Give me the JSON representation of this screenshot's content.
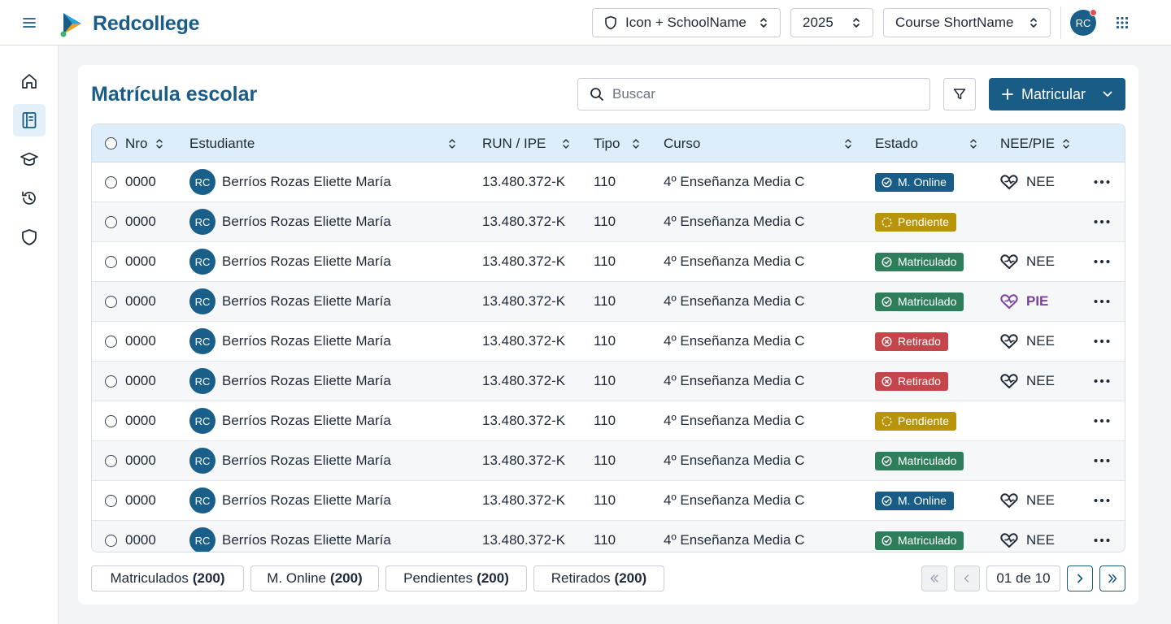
{
  "app": {
    "name": "Redcollege"
  },
  "topbar": {
    "school_select": "Icon + SchoolName",
    "year_select": "2025",
    "course_select": "Course ShortName",
    "user_initials": "RC"
  },
  "page": {
    "title": "Matrícula escolar",
    "search_placeholder": "Buscar",
    "primary_action": "Matricular"
  },
  "table": {
    "headers": {
      "nro": "Nro",
      "estudiante": "Estudiante",
      "run": "RUN / IPE",
      "tipo": "Tipo",
      "curso": "Curso",
      "estado": "Estado",
      "nee": "NEE/PIE"
    },
    "rows": [
      {
        "nro": "0000",
        "initials": "RC",
        "name": "Berríos Rozas Eliette María",
        "run": "13.480.372-K",
        "tipo": "110",
        "curso": "4º Enseñanza Media C",
        "estado": "M. Online",
        "estado_kind": "online",
        "nee": "NEE",
        "nee_kind": "nee"
      },
      {
        "nro": "0000",
        "initials": "RC",
        "name": "Berríos Rozas Eliette María",
        "run": "13.480.372-K",
        "tipo": "110",
        "curso": "4º Enseñanza Media C",
        "estado": "Pendiente",
        "estado_kind": "pendiente",
        "nee": "",
        "nee_kind": "none"
      },
      {
        "nro": "0000",
        "initials": "RC",
        "name": "Berríos Rozas Eliette María",
        "run": "13.480.372-K",
        "tipo": "110",
        "curso": "4º Enseñanza Media C",
        "estado": "Matriculado",
        "estado_kind": "matriculado",
        "nee": "NEE",
        "nee_kind": "nee"
      },
      {
        "nro": "0000",
        "initials": "RC",
        "name": "Berríos Rozas Eliette María",
        "run": "13.480.372-K",
        "tipo": "110",
        "curso": "4º Enseñanza Media C",
        "estado": "Matriculado",
        "estado_kind": "matriculado",
        "nee": "PIE",
        "nee_kind": "pie"
      },
      {
        "nro": "0000",
        "initials": "RC",
        "name": "Berríos Rozas Eliette María",
        "run": "13.480.372-K",
        "tipo": "110",
        "curso": "4º Enseñanza Media C",
        "estado": "Retirado",
        "estado_kind": "retirado",
        "nee": "NEE",
        "nee_kind": "nee"
      },
      {
        "nro": "0000",
        "initials": "RC",
        "name": "Berríos Rozas Eliette María",
        "run": "13.480.372-K",
        "tipo": "110",
        "curso": "4º Enseñanza Media C",
        "estado": "Retirado",
        "estado_kind": "retirado",
        "nee": "NEE",
        "nee_kind": "nee"
      },
      {
        "nro": "0000",
        "initials": "RC",
        "name": "Berríos Rozas Eliette María",
        "run": "13.480.372-K",
        "tipo": "110",
        "curso": "4º Enseñanza Media C",
        "estado": "Pendiente",
        "estado_kind": "pendiente",
        "nee": "",
        "nee_kind": "none"
      },
      {
        "nro": "0000",
        "initials": "RC",
        "name": "Berríos Rozas Eliette María",
        "run": "13.480.372-K",
        "tipo": "110",
        "curso": "4º Enseñanza Media C",
        "estado": "Matriculado",
        "estado_kind": "matriculado",
        "nee": "",
        "nee_kind": "none"
      },
      {
        "nro": "0000",
        "initials": "RC",
        "name": "Berríos Rozas Eliette María",
        "run": "13.480.372-K",
        "tipo": "110",
        "curso": "4º Enseñanza Media C",
        "estado": "M. Online",
        "estado_kind": "online",
        "nee": "NEE",
        "nee_kind": "nee"
      },
      {
        "nro": "0000",
        "initials": "RC",
        "name": "Berríos Rozas Eliette María",
        "run": "13.480.372-K",
        "tipo": "110",
        "curso": "4º Enseñanza Media C",
        "estado": "Matriculado",
        "estado_kind": "matriculado",
        "nee": "NEE",
        "nee_kind": "nee"
      }
    ]
  },
  "summary_chips": [
    {
      "label": "Matriculados",
      "count": "(200)"
    },
    {
      "label": "M. Online",
      "count": "(200)"
    },
    {
      "label": "Pendientes",
      "count": "(200)"
    },
    {
      "label": "Retirados",
      "count": "(200)"
    }
  ],
  "pagination": {
    "info": "01 de 10"
  },
  "colors": {
    "brand": "#195c86",
    "header_bg": "#ddeefa",
    "online": "#195c86",
    "pendiente": "#b8940a",
    "matriculado": "#2e7d5b",
    "retirado": "#c4464a",
    "pie": "#7b3fa0"
  }
}
